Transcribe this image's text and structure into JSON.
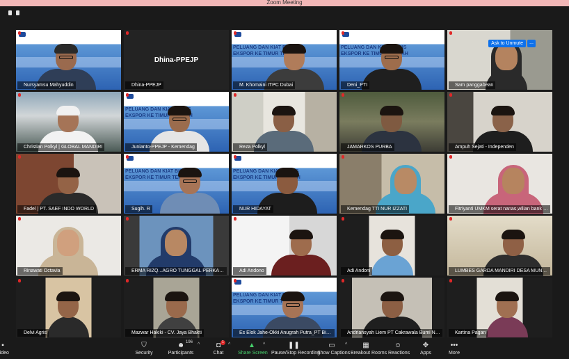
{
  "window": {
    "title": "Zoom Meeting"
  },
  "banner": {
    "ask_unmute": "Ask to Unmute",
    "more": "..."
  },
  "tiles": [
    {
      "name": "Nursyamsu Mahyuddin"
    },
    {
      "name": "Dhina-PPEJP",
      "center": "Dhina-PPEJP"
    },
    {
      "name": "M. Khomaini ITPC Dubai"
    },
    {
      "name": "Deni_PTI"
    },
    {
      "name": "Sam panggabean"
    },
    {
      "name": "Christian Polkyl | GLOBAL MANDIRI"
    },
    {
      "name": "Junianto-PPEJP - Kemendag"
    },
    {
      "name": "Reza Polkyl"
    },
    {
      "name": "JAMARKOS PURBA"
    },
    {
      "name": "Ampuh Sejati - Independen"
    },
    {
      "name": "Fadel | PT. SAEF INDO WORLD"
    },
    {
      "name": "Sugih. R"
    },
    {
      "name": "NUR HIDAYAT"
    },
    {
      "name": "Kemendag TTI NUR IZZATI"
    },
    {
      "name": "Fitriyanti UMKM serat nanas,wilian bank sums..."
    },
    {
      "name": "Rinawati Octavia"
    },
    {
      "name": "ERMA RIZQ...AGRO TUNGGAL PERKASA"
    },
    {
      "name": "Adi Andono"
    },
    {
      "name": "Adi Andoni"
    },
    {
      "name": "LUMBES GARDA MANDIRI DESA MUNJAN"
    },
    {
      "name": "Delvi Agris"
    },
    {
      "name": "Mazwar Hakiki - CV. Jaya Bhakti"
    },
    {
      "name": "Es Elok Jahe-Okki Anugrah Putra_PT Bin Amir E..."
    },
    {
      "name": "Andriansyah Liem PT Cakrawala Bumi Nagal"
    },
    {
      "name": "Kartina Pagan"
    }
  ],
  "slide": {
    "title_line1": "PELUANG DAN KIAT BISNIS",
    "title_line2": "EKSPOR KE TIMUR TENGAH"
  },
  "toolbar": {
    "video": "Video",
    "security": "Security",
    "participants": "Participants",
    "participants_count": "196",
    "chat": "Chat",
    "chat_badge": "1",
    "share": "Share Screen",
    "record": "Pause/Stop Recording",
    "captions": "Show Captions",
    "breakout": "Breakout Rooms",
    "reactions": "Reactions",
    "apps": "Apps",
    "more": "More"
  }
}
